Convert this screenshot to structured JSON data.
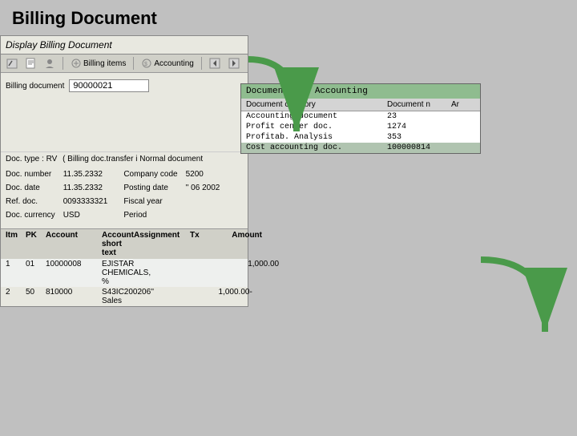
{
  "page": {
    "title": "Billing Document"
  },
  "billing_panel": {
    "title": "Display Billing Document",
    "toolbar": {
      "edit_icon": "✏",
      "items_label": "Billing items",
      "accounting_label": "Accounting"
    },
    "billing_doc_label": "Billing document",
    "billing_doc_value": "90000021",
    "doc_type_label": "Doc. type : RV",
    "doc_type_value": "( Billing doc.transfer i Normal document",
    "doc_number_label": "Doc. number",
    "doc_number_value": "11.35.2332",
    "doc_date_label": "Doc. date",
    "doc_date_value": "11.35.2332",
    "ref_doc_label": "Ref. doc.",
    "ref_doc_value": "0093333321",
    "doc_currency_label": "Doc. currency",
    "doc_currency_value": "USD",
    "company_code_label": "Company code",
    "company_code_value": "5200",
    "posting_date_label": "Posting date",
    "posting_date_value": "'' 06 2002",
    "fiscal_year_label": "Fiscal year",
    "period_label": "Period"
  },
  "items_table": {
    "headers": [
      "Itm",
      "PK",
      "Account",
      "Account short text",
      "Assignment",
      "Tx",
      "Amount"
    ],
    "rows": [
      {
        "itm": "1",
        "pk": "01",
        "account": "10000008",
        "text": "EJISTAR CHEMICALS, %",
        "assignment": "",
        "tx": "",
        "amount": "1,000.00"
      },
      {
        "itm": "2",
        "pk": "50",
        "account": "810000",
        "text": "S43IC Sales",
        "assignment": "200206''",
        "tx": "",
        "amount": "1,000.00-"
      }
    ]
  },
  "accounting_panel": {
    "title": "Documents in Accounting",
    "headers": {
      "category": "Document category",
      "doc_n": "Document n",
      "ar": "Ar"
    },
    "rows": [
      {
        "category": "Accounting document",
        "doc_n": "23",
        "ar": ""
      },
      {
        "category": "Profit center doc.",
        "doc_n": "1274",
        "ar": ""
      },
      {
        "category": "Profitab. Analysis",
        "doc_n": "353",
        "ar": ""
      },
      {
        "category": "Cost accounting doc.",
        "doc_n": "100000814",
        "ar": ""
      }
    ]
  },
  "arrows": {
    "down_color": "#4a9a4a",
    "right_down_color": "#4a9a4a"
  }
}
